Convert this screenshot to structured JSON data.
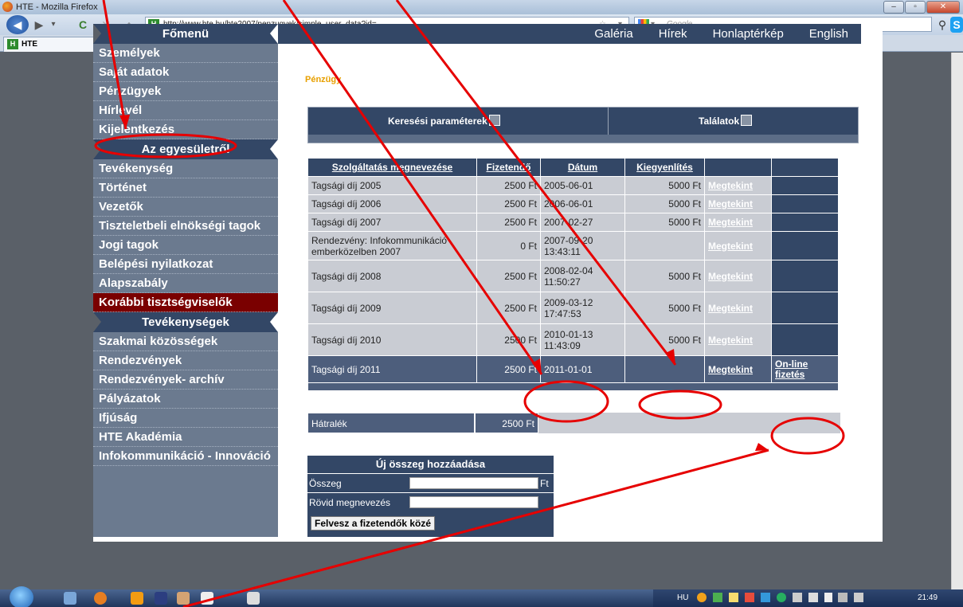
{
  "window": {
    "title": "HTE - Mozilla Firefox",
    "min": "–",
    "max": "▫",
    "close": "✕"
  },
  "browser": {
    "url": "http://www.hte.hu/hte2007/penzugyek/simple_user_data?id=",
    "search_placeholder": "Google",
    "tab_title": "HTE",
    "new_tab": "+",
    "favicon_letter": "H"
  },
  "sidebar": {
    "sections": [
      {
        "title": "Főmenü",
        "items": [
          "Személyek",
          "Saját adatok",
          "Pénzügyek",
          "Hírlevél",
          "Kijelentkezés"
        ]
      },
      {
        "title": "Az egyesületről",
        "items": [
          "Tevékenység",
          "Történet",
          "Vezetők",
          "Tiszteletbeli elnökségi tagok",
          "Jogi tagok",
          "Belépési nyilatkozat",
          "Alapszabály",
          "Korábbi tisztségviselők"
        ]
      },
      {
        "title": "Tevékenységek",
        "items": [
          "Szakmai közösségek",
          "Rendezvények",
          "Rendezvények- archív",
          "Pályázatok",
          "Ifjúság",
          "HTE Akadémia",
          "Infokommunikáció - Innováció"
        ]
      }
    ]
  },
  "topnav": [
    "Galéria",
    "Hírek",
    "Honlaptérkép",
    "English"
  ],
  "page_title": "Pénzügy",
  "search_box": {
    "params": "Keresési paraméterek",
    "results": "Találatok"
  },
  "table": {
    "headers": [
      "Szolgáltatás megnevezése",
      "Fizetendő",
      "Dátum",
      "Kiegyenlítés"
    ],
    "rows": [
      {
        "name": "Tagsági díj 2005",
        "amount": "2500 Ft",
        "date": "2005-06-01",
        "paid": "5000 Ft",
        "link": "Megtekint"
      },
      {
        "name": "Tagsági díj 2006",
        "amount": "2500 Ft",
        "date": "2006-06-01",
        "paid": "5000 Ft",
        "link": "Megtekint"
      },
      {
        "name": "Tagsági díj 2007",
        "amount": "2500 Ft",
        "date": "2007-02-27",
        "paid": "5000 Ft",
        "link": "Megtekint"
      },
      {
        "name": "Rendezvény: Infokommunikáció emberközelben 2007",
        "amount": "0 Ft",
        "date": "2007-09-20 13:43:11",
        "paid": "",
        "link": "Megtekint"
      },
      {
        "name": "Tagsági díj 2008",
        "amount": "2500 Ft",
        "date": "2008-02-04 11:50:27",
        "paid": "5000 Ft",
        "link": "Megtekint"
      },
      {
        "name": "Tagsági díj 2009",
        "amount": "2500 Ft",
        "date": "2009-03-12 17:47:53",
        "paid": "5000 Ft",
        "link": "Megtekint"
      },
      {
        "name": "Tagsági díj 2010",
        "amount": "2500 Ft",
        "date": "2010-01-13 11:43:09",
        "paid": "5000 Ft",
        "link": "Megtekint"
      },
      {
        "name": "Tagsági díj 2011",
        "amount": "2500 Ft",
        "date": "2011-01-01",
        "paid": "",
        "link": "Megtekint",
        "pay": "On-line fizetés"
      }
    ]
  },
  "arrears": {
    "label": "Hátralék",
    "value": "2500 Ft"
  },
  "new_amount": {
    "title": "Új összeg hozzáadása",
    "amount_label": "Összeg",
    "currency": "Ft",
    "name_label": "Rövid megnevezés",
    "button": "Felvesz a fizetendők közé"
  },
  "taskbar": {
    "lang": "HU",
    "time": "21:49"
  },
  "colors": {
    "nav": "#334766",
    "sidebar": "#6b7a8f",
    "highlight": "#7a0000",
    "accent": "#e8a000",
    "annotation": "#e60000"
  }
}
